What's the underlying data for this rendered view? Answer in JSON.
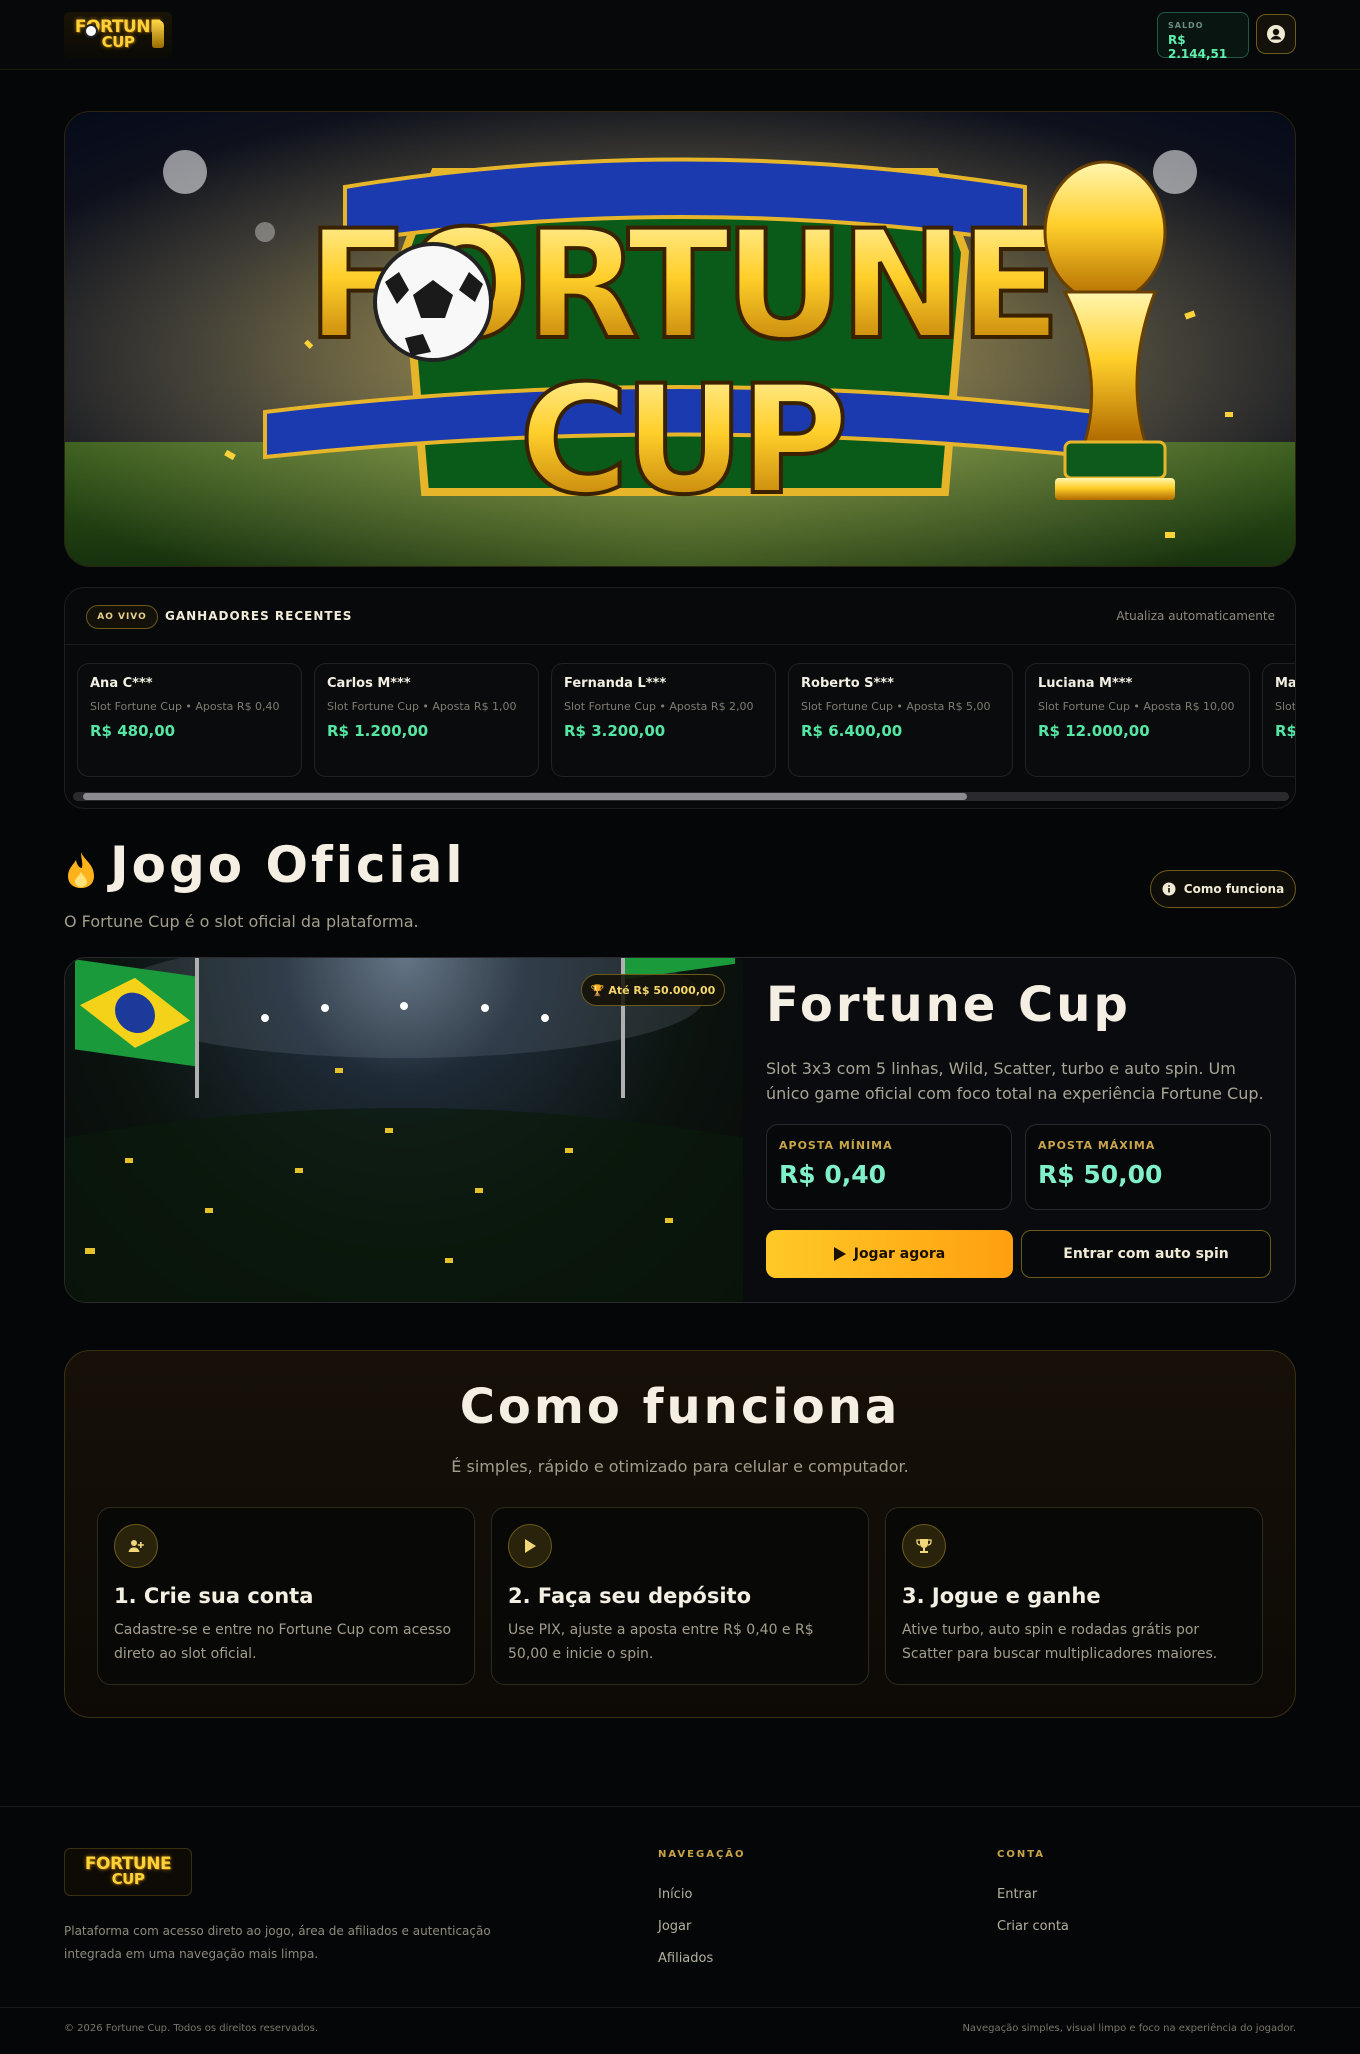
{
  "header": {
    "logo": {
      "line1": "FORTUNE",
      "line2": "CUP",
      "icon": "fortune-cup-logo"
    },
    "balance": {
      "label": "SALDO",
      "value": "R$ 2.144,51"
    },
    "profile_icon": "user-circle-icon"
  },
  "hero": {
    "title_line1": "FORTUNE",
    "title_line2": "CUP",
    "icon": "soccer-ball-trophy"
  },
  "winners": {
    "live_label": "AO VIVO",
    "title": "GANHADORES RECENTES",
    "note": "Atualiza automaticamente",
    "items": [
      {
        "name": "Ana C***",
        "line": "Slot Fortune Cup • Aposta R$ 0,40",
        "amount": "R$ 480,00"
      },
      {
        "name": "Carlos M***",
        "line": "Slot Fortune Cup • Aposta R$ 1,00",
        "amount": "R$ 1.200,00"
      },
      {
        "name": "Fernanda L***",
        "line": "Slot Fortune Cup • Aposta R$ 2,00",
        "amount": "R$ 3.200,00"
      },
      {
        "name": "Roberto S***",
        "line": "Slot Fortune Cup • Aposta R$ 5,00",
        "amount": "R$ 6.400,00"
      },
      {
        "name": "Luciana M***",
        "line": "Slot Fortune Cup • Aposta R$ 10,00",
        "amount": "R$ 12.000,00"
      },
      {
        "name": "Ma",
        "line": "Slot R$",
        "amount": "R$"
      }
    ]
  },
  "official": {
    "title": "Jogo Oficial",
    "subtitle": "O Fortune Cup é o slot oficial da plataforma.",
    "how_button": "Como funciona",
    "icon": "flame-icon"
  },
  "game": {
    "jackpot": "Até R$ 50.000,00",
    "name": "Fortune Cup",
    "description": "Slot 3x3 com 5 linhas, Wild, Scatter, turbo e auto spin. Um único game oficial com foco total na experiência Fortune Cup.",
    "min_label": "APOSTA MÍNIMA",
    "min_value": "R$ 0,40",
    "max_label": "APOSTA MÁXIMA",
    "max_value": "R$ 50,00",
    "play_button": "Jogar agora",
    "auto_button": "Entrar com auto spin"
  },
  "how": {
    "title": "Como funciona",
    "subtitle": "É simples, rápido e otimizado para celular e computador.",
    "steps": [
      {
        "title": "1. Crie sua conta",
        "desc": "Cadastre-se e entre no Fortune Cup com acesso direto ao slot oficial.",
        "icon": "user-plus-icon"
      },
      {
        "title": "2. Faça seu depósito",
        "desc": "Use PIX, ajuste a aposta entre R$ 0,40 e R$ 50,00 e inicie o spin.",
        "icon": "play-icon"
      },
      {
        "title": "3. Jogue e ganhe",
        "desc": "Ative turbo, auto spin e rodadas grátis por Scatter para buscar multiplicadores maiores.",
        "icon": "trophy-icon"
      }
    ]
  },
  "footer": {
    "description": "Plataforma com acesso direto ao jogo, área de afiliados e autenticação integrada em uma navegação mais limpa.",
    "nav_heading": "NAVEGAÇÃO",
    "nav_links": [
      "Início",
      "Jogar",
      "Afiliados"
    ],
    "account_heading": "CONTA",
    "account_links": [
      "Entrar",
      "Criar conta"
    ],
    "copyright": "© 2026 Fortune Cup. Todos os direitos reservados.",
    "tagline": "Navegação simples, visual limpo e foco na experiência do jogador."
  },
  "colors": {
    "accent_gold": "#ffc927",
    "accent_green": "#56e6a4",
    "background": "#050607"
  }
}
